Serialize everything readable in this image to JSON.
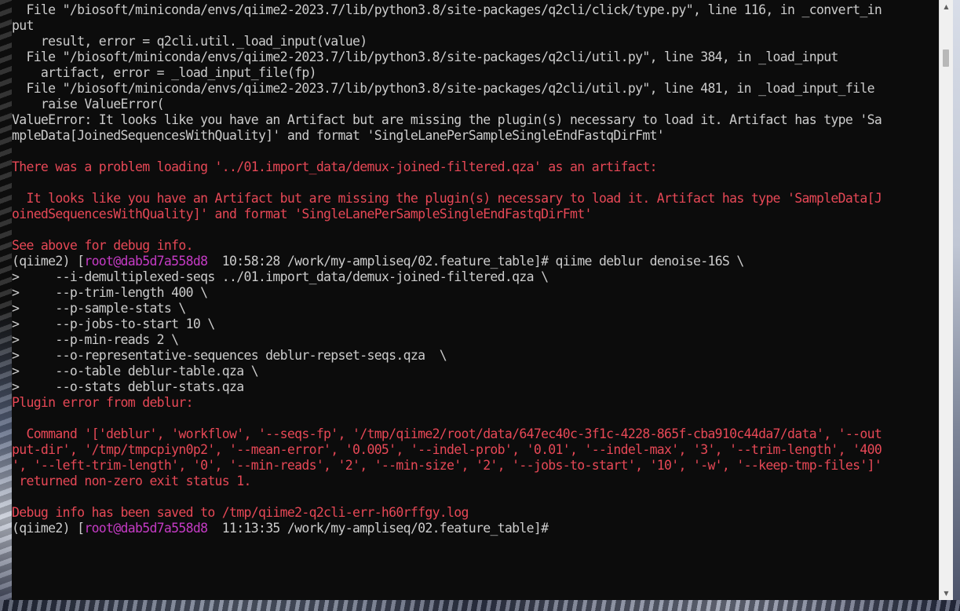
{
  "terminal": {
    "lines": [
      {
        "type": "text",
        "text": "  File \"/biosoft/miniconda/envs/qiime2-2023.7/lib/python3.8/site-packages/q2cli/click/type.py\", line 116, in _convert_in"
      },
      {
        "type": "text",
        "text": "put"
      },
      {
        "type": "text",
        "text": "    result, error = q2cli.util._load_input(value)"
      },
      {
        "type": "text",
        "text": "  File \"/biosoft/miniconda/envs/qiime2-2023.7/lib/python3.8/site-packages/q2cli/util.py\", line 384, in _load_input"
      },
      {
        "type": "text",
        "text": "    artifact, error = _load_input_file(fp)"
      },
      {
        "type": "text",
        "text": "  File \"/biosoft/miniconda/envs/qiime2-2023.7/lib/python3.8/site-packages/q2cli/util.py\", line 481, in _load_input_file"
      },
      {
        "type": "text",
        "text": "    raise ValueError("
      },
      {
        "type": "text",
        "text": "ValueError: It looks like you have an Artifact but are missing the plugin(s) necessary to load it. Artifact has type 'Sa"
      },
      {
        "type": "text",
        "text": "mpleData[JoinedSequencesWithQuality]' and format 'SingleLanePerSampleSingleEndFastqDirFmt'"
      },
      {
        "type": "text",
        "text": ""
      },
      {
        "type": "error",
        "text": "There was a problem loading '../01.import_data/demux-joined-filtered.qza' as an artifact:"
      },
      {
        "type": "error",
        "text": ""
      },
      {
        "type": "error",
        "text": "  It looks like you have an Artifact but are missing the plugin(s) necessary to load it. Artifact has type 'SampleData[J"
      },
      {
        "type": "error",
        "text": "oinedSequencesWithQuality]' and format 'SingleLanePerSampleSingleEndFastqDirFmt'"
      },
      {
        "type": "error",
        "text": ""
      },
      {
        "type": "error",
        "text": "See above for debug info."
      },
      {
        "type": "prompt",
        "env": "(qiime2) [",
        "user": "root@dab5d7a558d8",
        "rest": "  10:58:28 /work/my-ampliseq/02.feature_table]# qiime deblur denoise-16S \\"
      },
      {
        "type": "text",
        "text": ">     --i-demultiplexed-seqs ../01.import_data/demux-joined-filtered.qza \\"
      },
      {
        "type": "text",
        "text": ">     --p-trim-length 400 \\"
      },
      {
        "type": "text",
        "text": ">     --p-sample-stats \\"
      },
      {
        "type": "text",
        "text": ">     --p-jobs-to-start 10 \\"
      },
      {
        "type": "text",
        "text": ">     --p-min-reads 2 \\"
      },
      {
        "type": "text",
        "text": ">     --o-representative-sequences deblur-repset-seqs.qza  \\"
      },
      {
        "type": "text",
        "text": ">     --o-table deblur-table.qza \\"
      },
      {
        "type": "text",
        "text": ">     --o-stats deblur-stats.qza"
      },
      {
        "type": "error",
        "text": "Plugin error from deblur:"
      },
      {
        "type": "error",
        "text": ""
      },
      {
        "type": "error",
        "text": "  Command '['deblur', 'workflow', '--seqs-fp', '/tmp/qiime2/root/data/647ec40c-3f1c-4228-865f-cba910c44da7/data', '--out"
      },
      {
        "type": "error",
        "text": "put-dir', '/tmp/tmpcpiyn0p2', '--mean-error', '0.005', '--indel-prob', '0.01', '--indel-max', '3', '--trim-length', '400"
      },
      {
        "type": "error",
        "text": "', '--left-trim-length', '0', '--min-reads', '2', '--min-size', '2', '--jobs-to-start', '10', '-w', '--keep-tmp-files']'"
      },
      {
        "type": "error",
        "text": " returned non-zero exit status 1."
      },
      {
        "type": "error",
        "text": ""
      },
      {
        "type": "error",
        "text": "Debug info has been saved to /tmp/qiime2-q2cli-err-h60rffgy.log"
      },
      {
        "type": "prompt",
        "env": "(qiime2) [",
        "user": "root@dab5d7a558d8",
        "rest": "  11:13:35 /work/my-ampliseq/02.feature_table]#"
      }
    ]
  },
  "colors": {
    "background": "#0c0c0c",
    "text": "#cccccc",
    "error": "#e74856",
    "user": "#c53bc5"
  },
  "scrollbar": {
    "up_icon": "triangle-up",
    "down_icon": "triangle-down"
  }
}
